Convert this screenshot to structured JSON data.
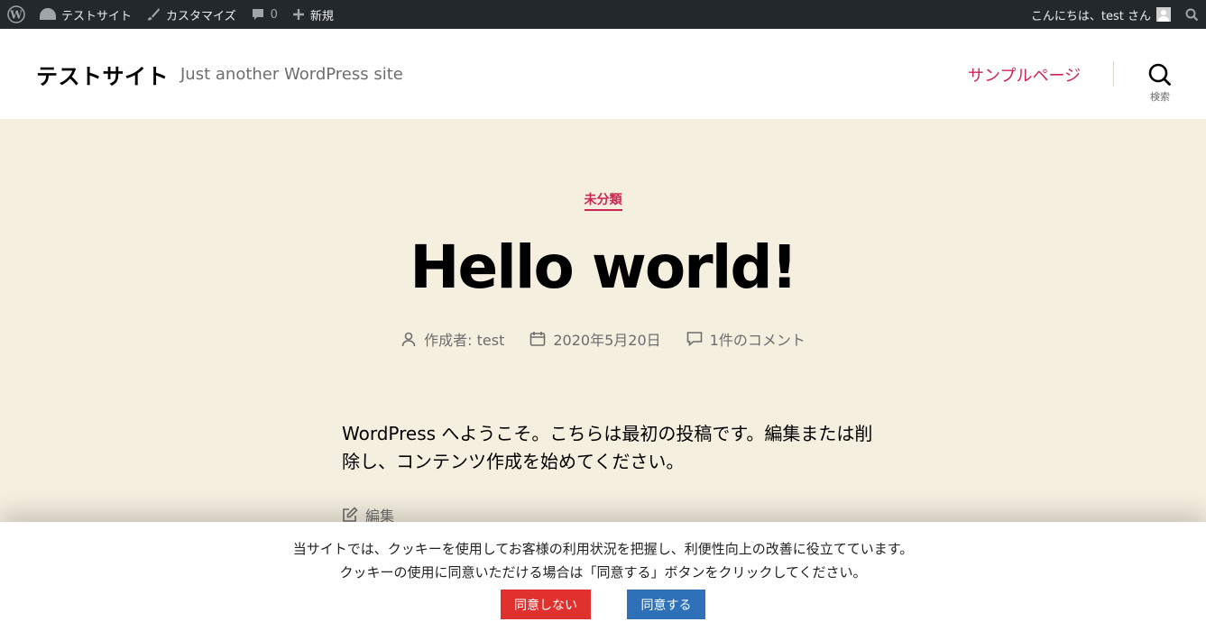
{
  "adminbar": {
    "site_name": "テストサイト",
    "customize": "カスタマイズ",
    "comments_count": "0",
    "new": "新規",
    "greeting": "こんにちは、test さん"
  },
  "header": {
    "site_title": "テストサイト",
    "tagline": "Just another WordPress site",
    "nav_link": "サンプルページ",
    "search_label": "検索"
  },
  "post": {
    "category": "未分類",
    "title": "Hello world!",
    "author": "作成者: test",
    "date": "2020年5月20日",
    "comments": "1件のコメント",
    "content": "WordPress へようこそ。こちらは最初の投稿です。編集または削除し、コンテンツ作成を始めてください。",
    "edit_label": "編集"
  },
  "cookie": {
    "line1": "当サイトでは、クッキーを使用してお客様の利用状況を把握し、利便性向上の改善に役立てています。",
    "line2": "クッキーの使用に同意いただける場合は「同意する」ボタンをクリックしてください。",
    "decline": "同意しない",
    "accept": "同意する"
  },
  "colors": {
    "accent": "#cd2653",
    "adminbar": "#23282d",
    "page_bg": "#f5efe0",
    "decline_button": "#e0312f",
    "accept_button": "#2e71b8"
  }
}
